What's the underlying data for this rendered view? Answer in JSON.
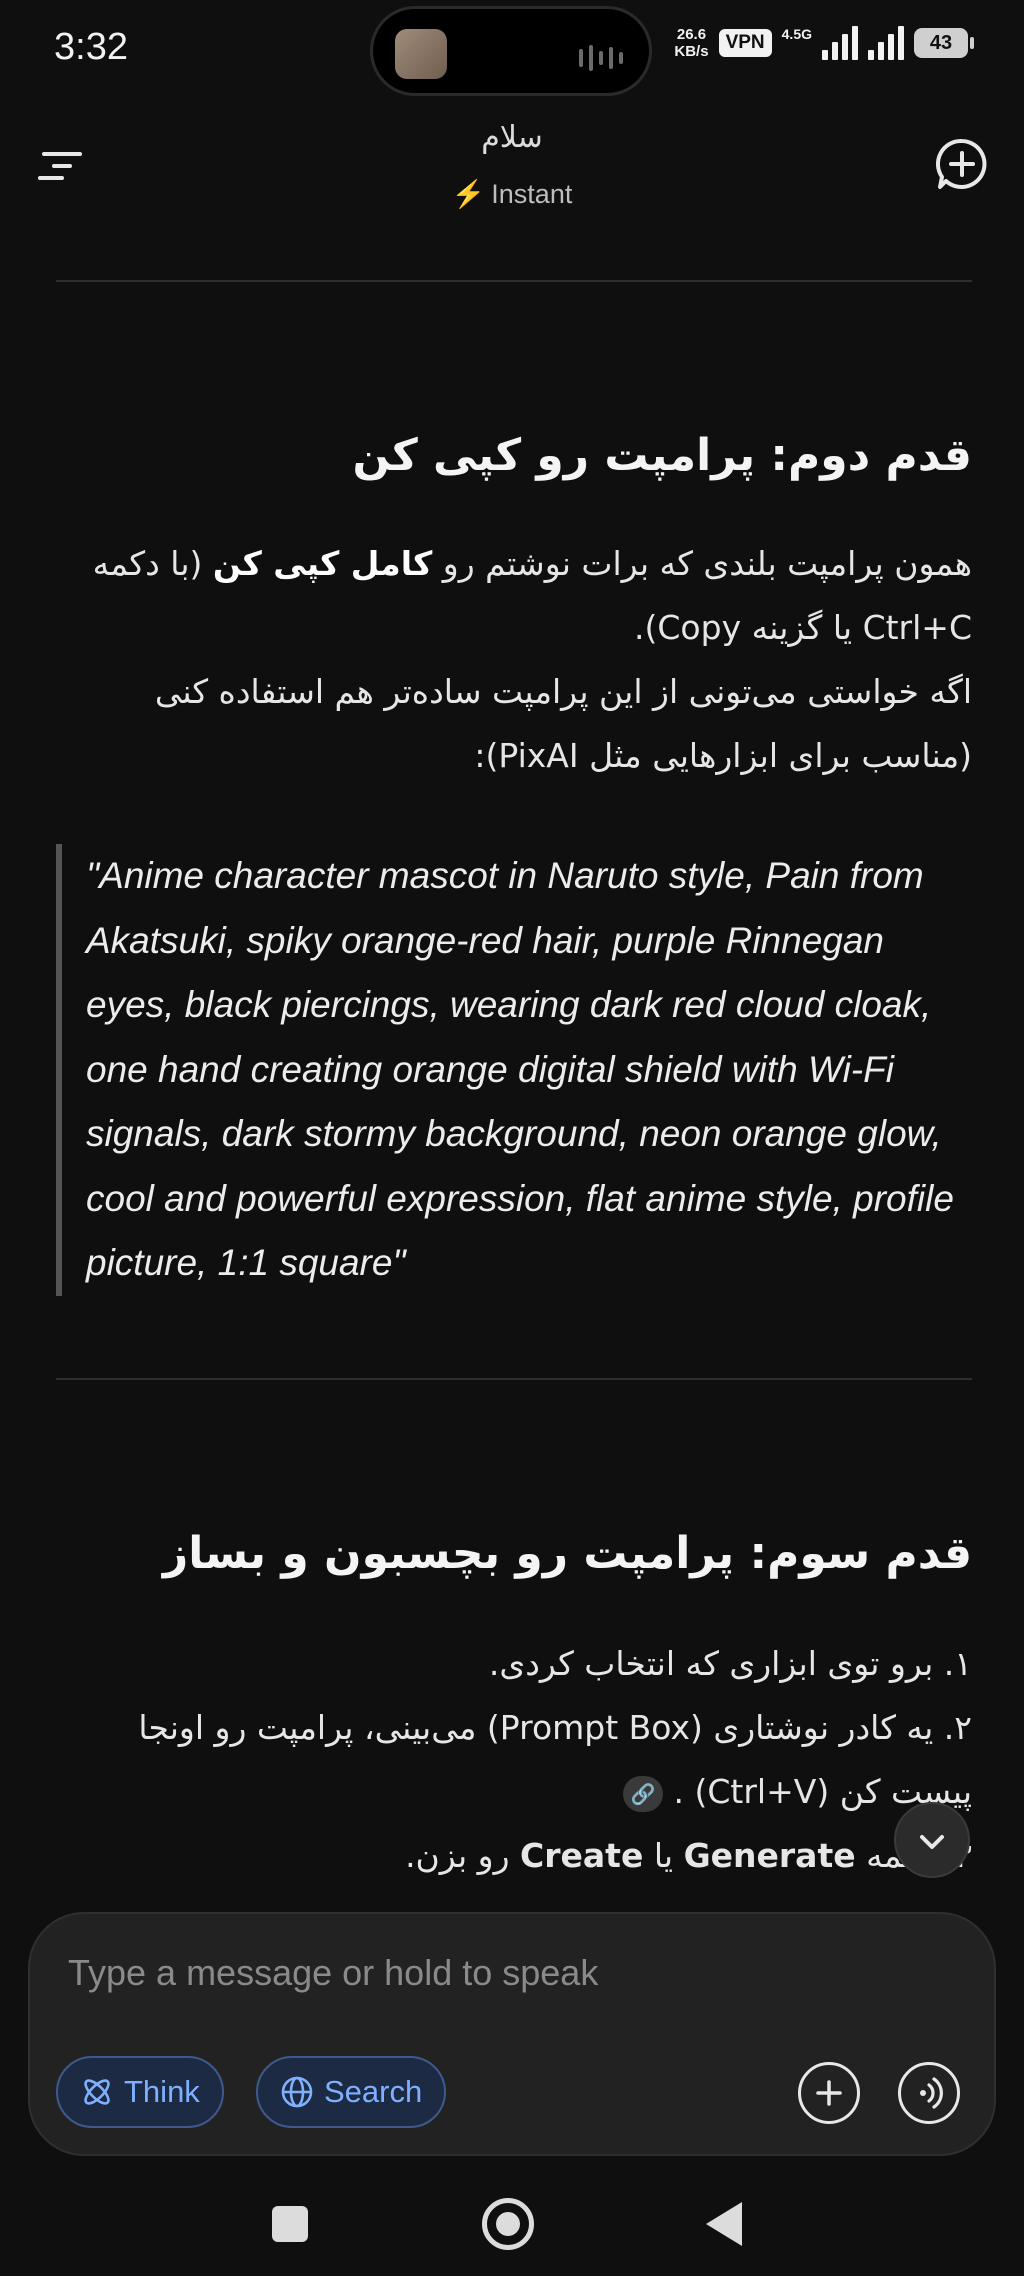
{
  "status_bar": {
    "time": "3:32",
    "net_speed_value": "26.6",
    "net_speed_unit": "KB/s",
    "vpn": "VPN",
    "network_type": "4.5G",
    "battery": "43"
  },
  "header": {
    "title": "سلام",
    "model": "Instant"
  },
  "content": {
    "step2_heading": "قدم دوم: پرامپت رو کپی کن",
    "step2_p1_pre": "همون پرامپت بلندی که برات نوشتم رو ",
    "step2_p1_bold": "کامل کپی کن",
    "step2_p1_post": " (با دکمه Ctrl+C یا گزینه Copy).",
    "step2_p2": "اگه خواستی می‌تونی از این پرامپت ساده‌تر هم استفاده کنی (مناسب برای ابزارهایی مثل PixAI):",
    "quote": "\"Anime character mascot in Naruto style, Pain from Akatsuki, spiky orange-red hair, purple Rinnegan eyes, black piercings, wearing dark red cloud cloak, one hand creating orange digital shield with Wi-Fi signals, dark stormy background, neon orange glow, cool and powerful expression, flat anime style, profile picture, 1:1 square\"",
    "step3_heading": "قدم سوم: پرامپت رو بچسبون و بساز",
    "step3_items": [
      "۱. برو توی ابزاری که انتخاب کردی.",
      "۲. یه کادر نوشتاری (Prompt Box) می‌بینی، پرامپت رو اونجا پیست کن (Ctrl+V) .",
      "۳. دکمه Generate یا Create رو بزن."
    ],
    "step3_item3_pre": "۳. دکمه ",
    "step3_item3_generate": "Generate",
    "step3_item3_mid": " یا ",
    "step3_item3_create": "Create",
    "step3_item3_post": " رو بزن."
  },
  "composer": {
    "placeholder": "Type a message or hold to speak",
    "think_label": "Think",
    "search_label": "Search"
  },
  "colors": {
    "background": "#0f0f0f",
    "accent": "#7fb0ff",
    "bolt": "#5aa0ff"
  }
}
